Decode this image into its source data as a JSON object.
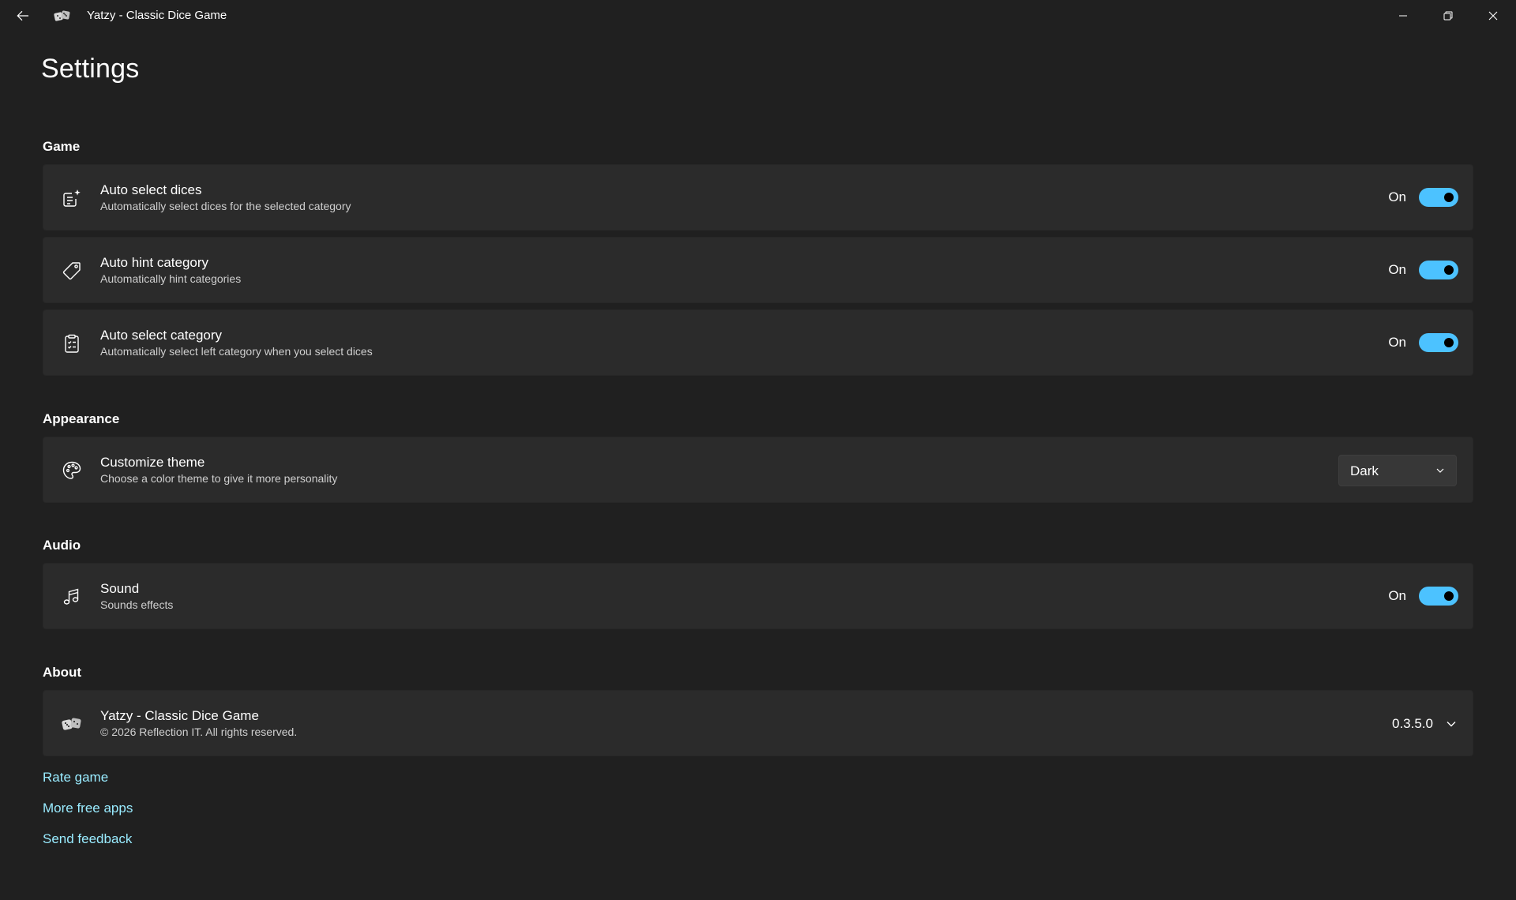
{
  "window": {
    "title": "Yatzy - Classic Dice Game"
  },
  "page": {
    "title": "Settings"
  },
  "colors": {
    "background": "#202020",
    "card": "#2b2b2b",
    "accent": "#4cc2ff",
    "link": "#99ebff"
  },
  "sections": {
    "game": {
      "title": "Game",
      "items": [
        {
          "icon": "note-sparkle-icon",
          "title": "Auto select dices",
          "description": "Automatically select dices for the selected category",
          "state": "On",
          "enabled": true
        },
        {
          "icon": "tag-icon",
          "title": "Auto hint category",
          "description": "Automatically hint categories",
          "state": "On",
          "enabled": true
        },
        {
          "icon": "clipboard-checklist-icon",
          "title": "Auto select category",
          "description": "Automatically select left category when you select dices",
          "state": "On",
          "enabled": true
        }
      ]
    },
    "appearance": {
      "title": "Appearance",
      "theme": {
        "icon": "palette-icon",
        "title": "Customize theme",
        "description": "Choose a color theme to give it more personality",
        "selected": "Dark"
      }
    },
    "audio": {
      "title": "Audio",
      "sound": {
        "icon": "music-note-icon",
        "title": "Sound",
        "description": "Sounds effects",
        "state": "On",
        "enabled": true
      }
    },
    "about": {
      "title": "About",
      "app": {
        "icon": "dice-icon",
        "title": "Yatzy - Classic Dice Game",
        "copyright": "© 2026 Reflection IT. All rights reserved.",
        "version": "0.3.5.0"
      }
    }
  },
  "links": {
    "rate": "Rate game",
    "more_apps": "More free apps",
    "feedback": "Send feedback"
  }
}
